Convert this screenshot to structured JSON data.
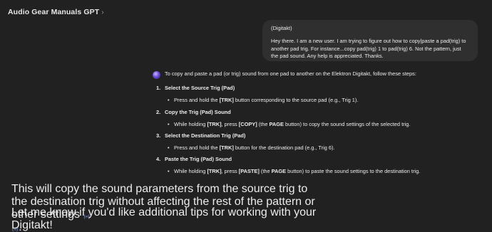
{
  "header": {
    "title": "Audio Gear Manuals GPT",
    "chevron": "›"
  },
  "user_message": {
    "line1": "(Digitakt)",
    "line2": "Hey there. I am a new user. I am trying to figure out how to copy|paste a pad(trig) to another pad trig. For instance...copy pad(trig) 1 to pad(trig) 6. Not the pattern, just the pad sound. Any help is appreciated. Thanks."
  },
  "assistant": {
    "intro": "To copy and paste a pad (or trig) sound from one pad to another on the Elektron Digitakt, follow these steps:",
    "steps": [
      {
        "num": "1.",
        "title": "Select the Source Trig (Pad)",
        "b1": "Press and hold the ",
        "k1": "[TRK]",
        "b2": " button corresponding to the source pad (e.g., Trig 1)."
      },
      {
        "num": "2.",
        "title": "Copy the Trig (Pad) Sound",
        "b1": "While holding ",
        "k1": "[TRK]",
        "b2": ", press ",
        "k2": "[COPY]",
        "b3": " (the ",
        "k3": "PAGE",
        "b4": " button) to copy the sound settings of the selected trig."
      },
      {
        "num": "3.",
        "title": "Select the Destination Trig (Pad)",
        "b1": "Press and hold the ",
        "k1": "[TRK]",
        "b2": " button for the destination pad (e.g., Trig 6)."
      },
      {
        "num": "4.",
        "title": "Paste the Trig (Pad) Sound",
        "b1": "While holding ",
        "k1": "[TRK]",
        "b2": ", press ",
        "k2": "[PASTE]",
        "b3": " (the ",
        "k3": "PAGE",
        "b4": " button) to paste the sound settings to the destination trig."
      }
    ],
    "outro_a": "This will copy the sound parameters from the source trig to the destination trig without affecting the rest of the pattern or other settings ",
    "cite1": "(∞)",
    "outro_b": "",
    "cite2": "(∞)",
    "outro_c": ".",
    "closing": "Let me know if you'd like additional tips for working with your Digitakt!"
  }
}
